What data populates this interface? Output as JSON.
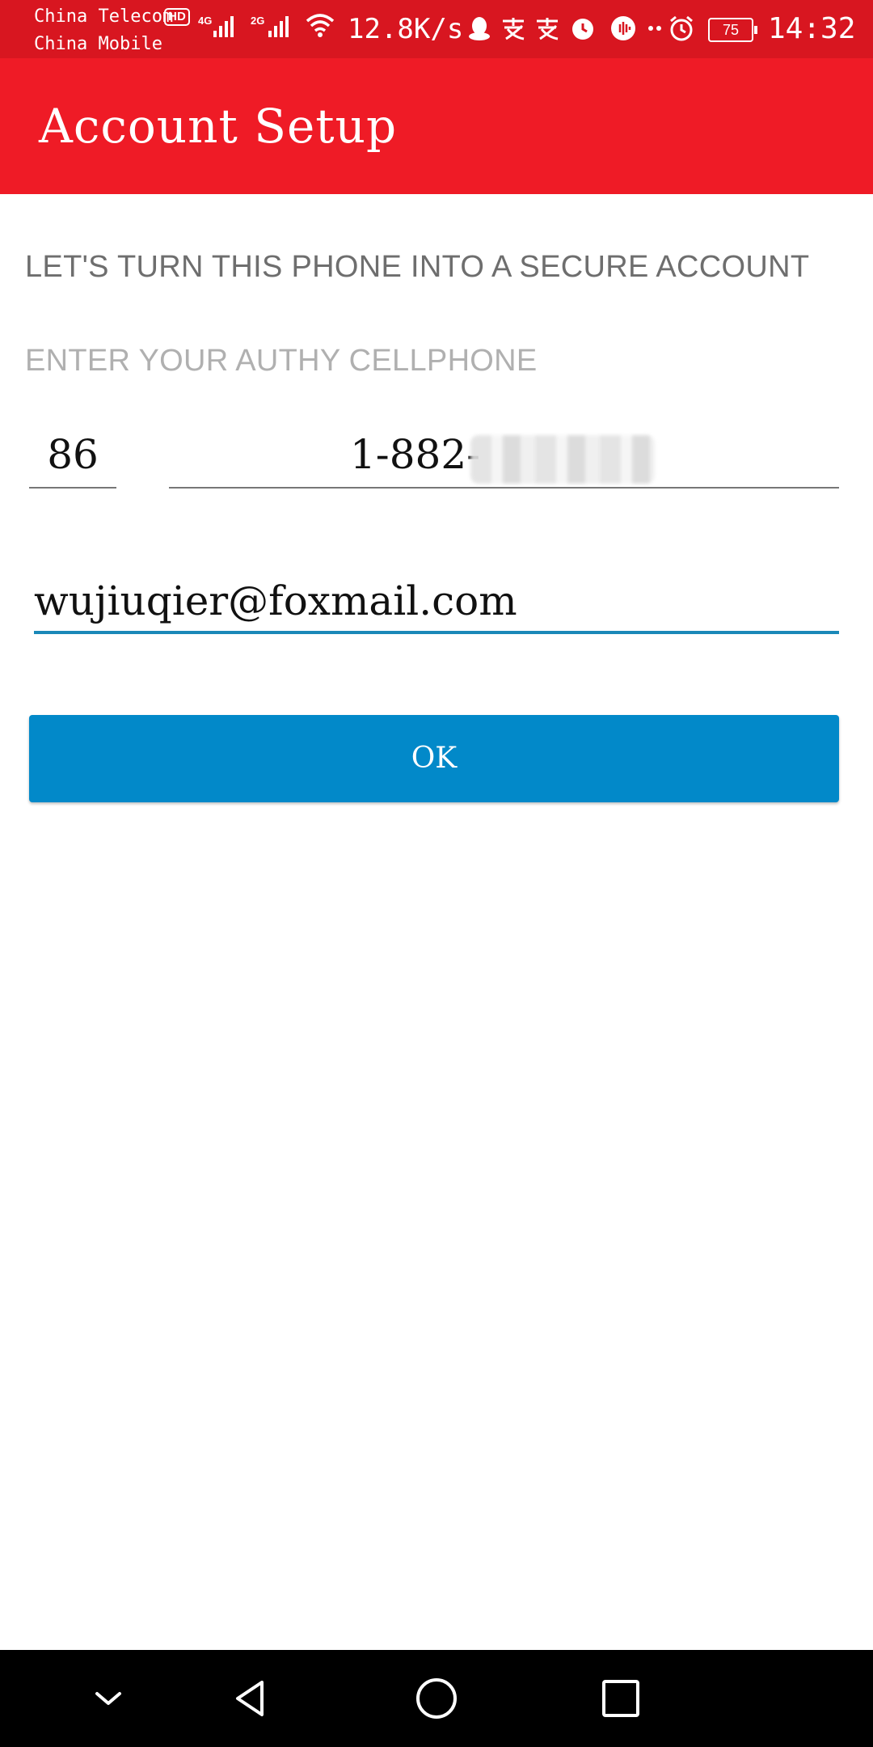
{
  "status_bar": {
    "carrier_1": "China Telecom",
    "carrier_2": "China Mobile",
    "hd_badge": "HD",
    "network_1": "4G",
    "network_2": "2G",
    "speed": "12.8K/s",
    "battery": "75",
    "time": "14:32"
  },
  "app_bar": {
    "title": "Account Setup"
  },
  "content": {
    "headline": "LET'S TURN THIS PHONE INTO A SECURE ACCOUNT",
    "subhead": "ENTER YOUR AUTHY CELLPHONE",
    "country_code": "86",
    "phone_number": "1-882-",
    "email": "wujiuqier@foxmail.com",
    "ok_label": "OK"
  },
  "colors": {
    "status_bar": "#d81620",
    "app_bar": "#ef1b26",
    "button": "#0289c9",
    "email_underline": "#1a88b8"
  },
  "nav_bar": {
    "icons": [
      "chevron-down-icon",
      "back-icon",
      "home-icon",
      "recents-icon"
    ]
  }
}
